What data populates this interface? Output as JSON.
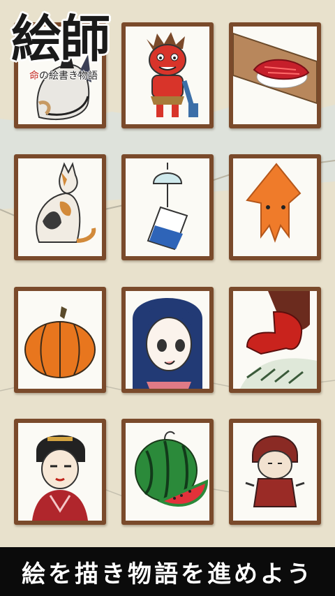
{
  "logo": {
    "title": "絵師",
    "subtitle_mark": "命",
    "subtitle_text": "の絵書き物語"
  },
  "banner": {
    "text": "絵を描き物語を進めよう"
  },
  "cards": [
    {
      "icon": "cat-sketch-icon"
    },
    {
      "icon": "red-oni-icon"
    },
    {
      "icon": "tuna-sushi-icon"
    },
    {
      "icon": "calico-cat-icon"
    },
    {
      "icon": "wind-chime-icon"
    },
    {
      "icon": "squid-icon"
    },
    {
      "icon": "pumpkin-icon"
    },
    {
      "icon": "anime-girl-icon"
    },
    {
      "icon": "tengu-icon"
    },
    {
      "icon": "geisha-icon"
    },
    {
      "icon": "watermelon-icon"
    },
    {
      "icon": "child-in-hood-icon"
    }
  ],
  "colors": {
    "frame": "#7a4a2b",
    "paper": "#fbfaf5",
    "background": "#e9e2cf",
    "banner": "#0b0b0b"
  }
}
